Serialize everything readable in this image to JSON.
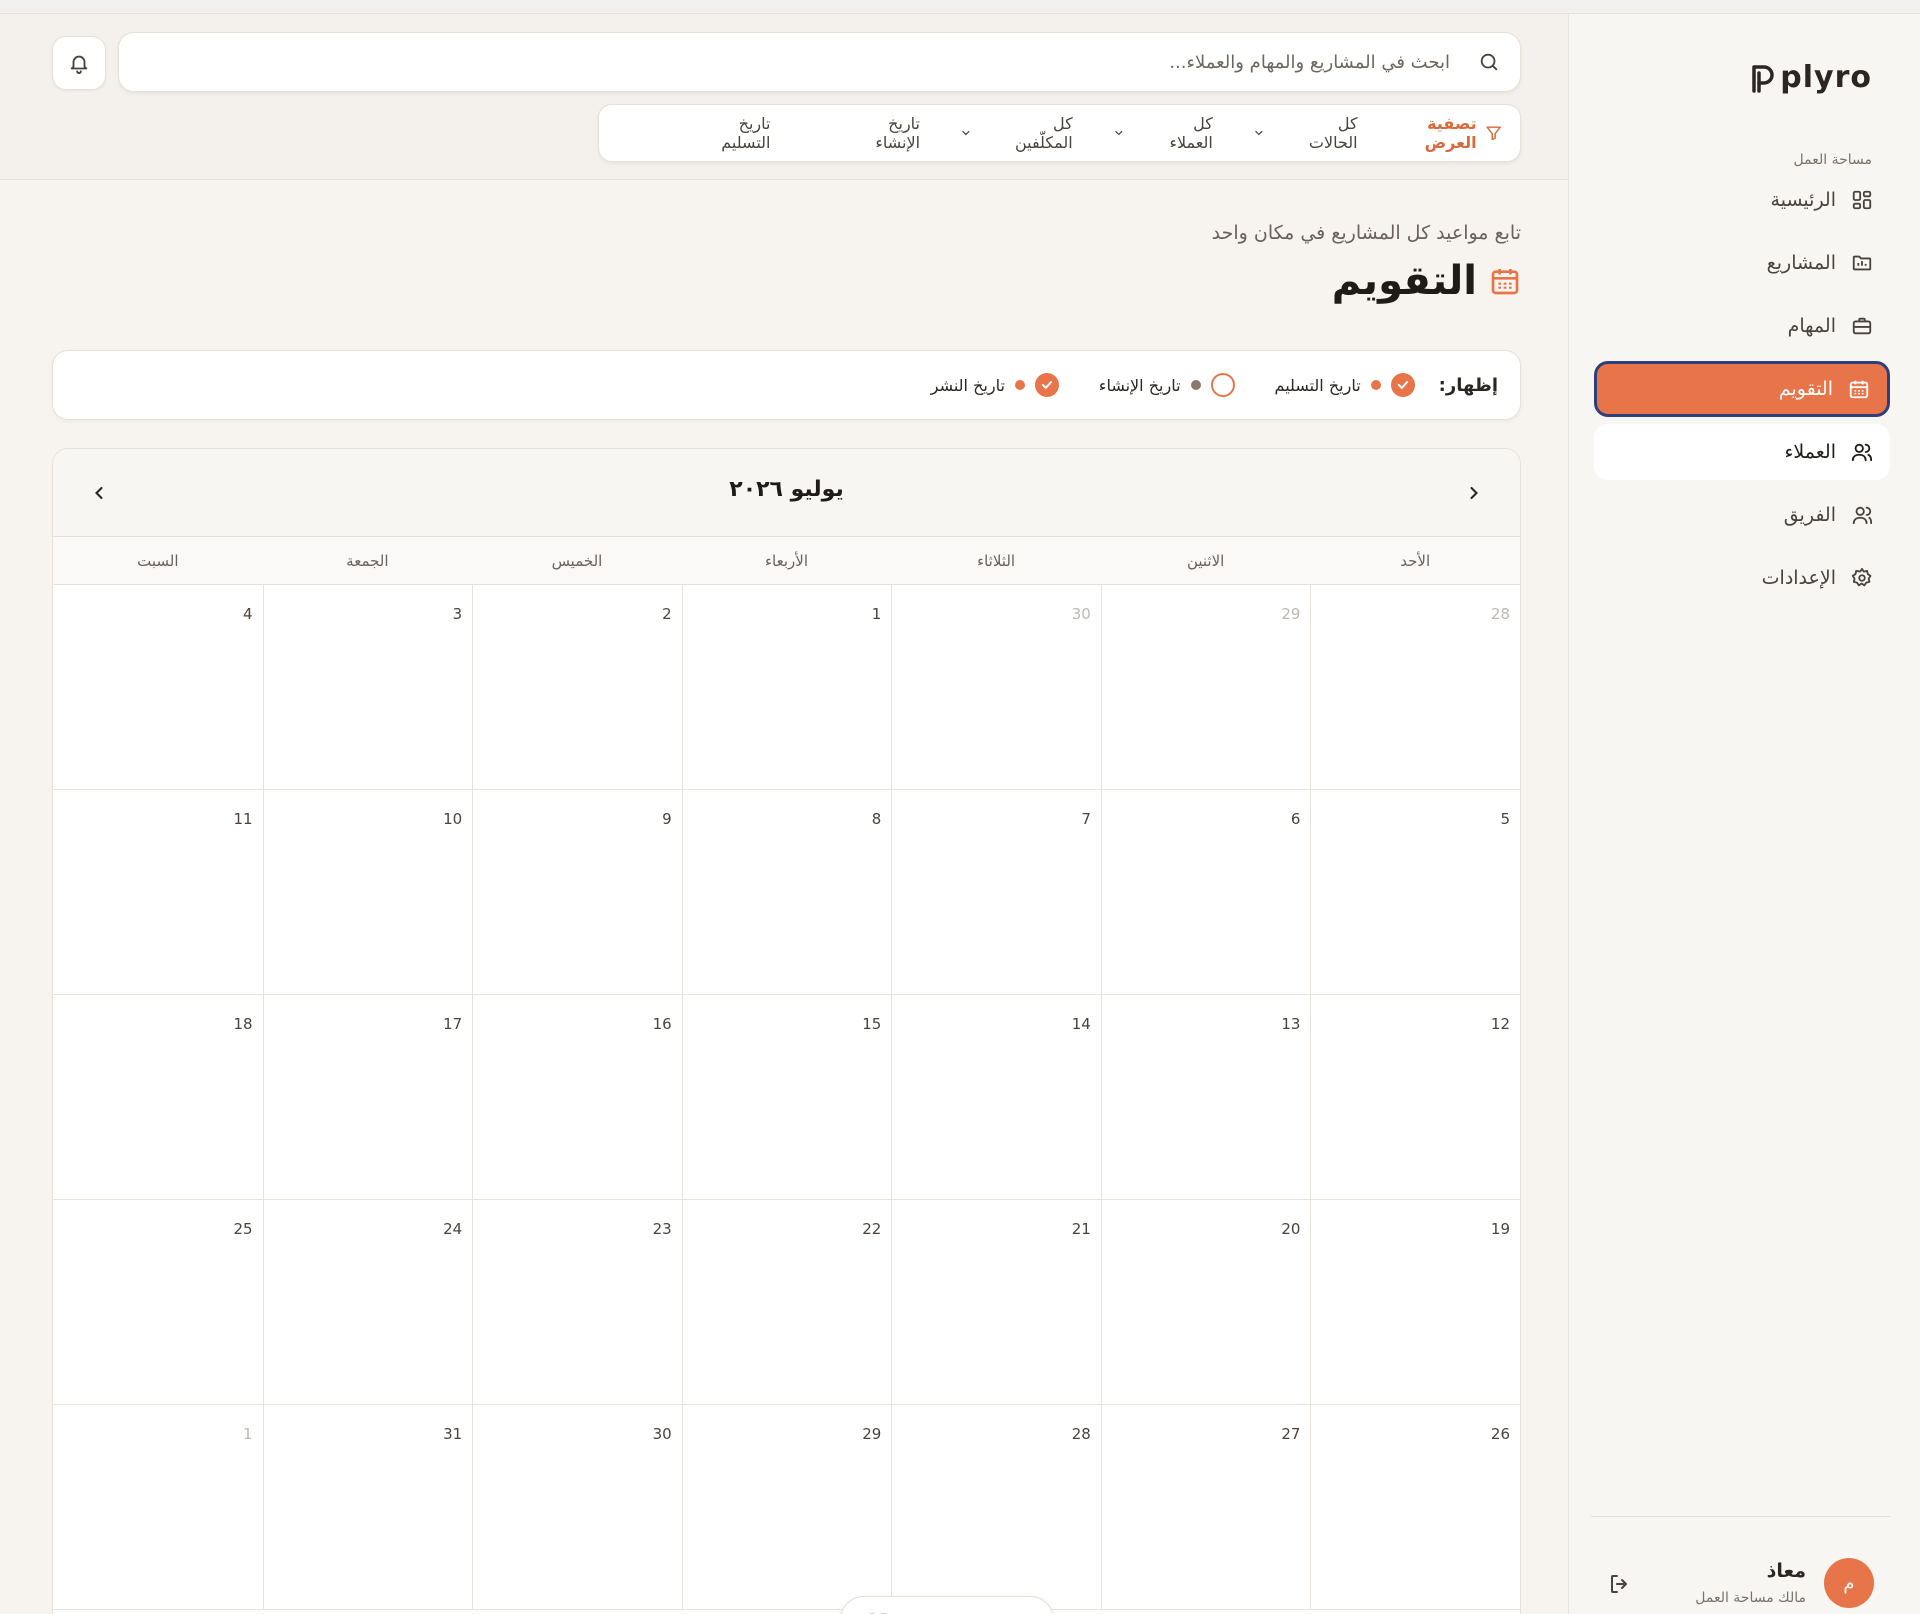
{
  "app": {
    "logo": "plyro"
  },
  "sidebar": {
    "section_label": "مساحة العمل",
    "items": [
      {
        "label": "الرئيسية",
        "icon": "grid-icon"
      },
      {
        "label": "المشاريع",
        "icon": "folder-icon"
      },
      {
        "label": "المهام",
        "icon": "briefcase-icon"
      },
      {
        "label": "التقويم",
        "icon": "calendar-icon"
      },
      {
        "label": "العملاء",
        "icon": "user-icon"
      },
      {
        "label": "الفريق",
        "icon": "users-icon"
      },
      {
        "label": "الإعدادات",
        "icon": "gear-icon"
      }
    ],
    "user": {
      "initial": "م",
      "name": "معاذ",
      "role": "مالك مساحة العمل"
    }
  },
  "header": {
    "search_placeholder": "ابحث في المشاريع والمهام والعملاء...",
    "filter_title": "تصفية العرض",
    "filters": [
      "كل الحالات",
      "كل العملاء",
      "كل المكلّفين",
      "تاريخ الإنشاء"
    ],
    "sort_label": "تاريخ التسليم"
  },
  "page": {
    "subtitle": "تابع مواعيد كل المشاريع في مكان واحد",
    "title": "التقويم"
  },
  "legend": {
    "label": "إظهار:",
    "items": [
      {
        "label": "تاريخ التسليم",
        "checked": true,
        "color": "#e87549"
      },
      {
        "label": "تاريخ الإنشاء",
        "checked": false,
        "color": "#8a7a6e"
      },
      {
        "label": "تاريخ النشر",
        "checked": true,
        "color": "#e87549"
      }
    ]
  },
  "calendar": {
    "month_label": "يوليو ٢٠٢٦",
    "weekdays": [
      "الأحد",
      "الاثنين",
      "الثلاثاء",
      "الأربعاء",
      "الخميس",
      "الجمعة",
      "السبت"
    ],
    "days": [
      {
        "n": "28",
        "other": true
      },
      {
        "n": "29",
        "other": true
      },
      {
        "n": "30",
        "other": true
      },
      {
        "n": "1"
      },
      {
        "n": "2"
      },
      {
        "n": "3"
      },
      {
        "n": "4"
      },
      {
        "n": "5"
      },
      {
        "n": "6"
      },
      {
        "n": "7"
      },
      {
        "n": "8"
      },
      {
        "n": "9"
      },
      {
        "n": "10"
      },
      {
        "n": "11"
      },
      {
        "n": "12"
      },
      {
        "n": "13"
      },
      {
        "n": "14"
      },
      {
        "n": "15"
      },
      {
        "n": "16"
      },
      {
        "n": "17"
      },
      {
        "n": "18"
      },
      {
        "n": "19"
      },
      {
        "n": "20"
      },
      {
        "n": "21"
      },
      {
        "n": "22"
      },
      {
        "n": "23"
      },
      {
        "n": "24"
      },
      {
        "n": "25"
      },
      {
        "n": "26"
      },
      {
        "n": "27"
      },
      {
        "n": "28"
      },
      {
        "n": "29"
      },
      {
        "n": "30"
      },
      {
        "n": "31"
      },
      {
        "n": "1",
        "other": true
      }
    ]
  },
  "colors": {
    "accent": "#e87549",
    "active_border": "#2f3f7a"
  }
}
